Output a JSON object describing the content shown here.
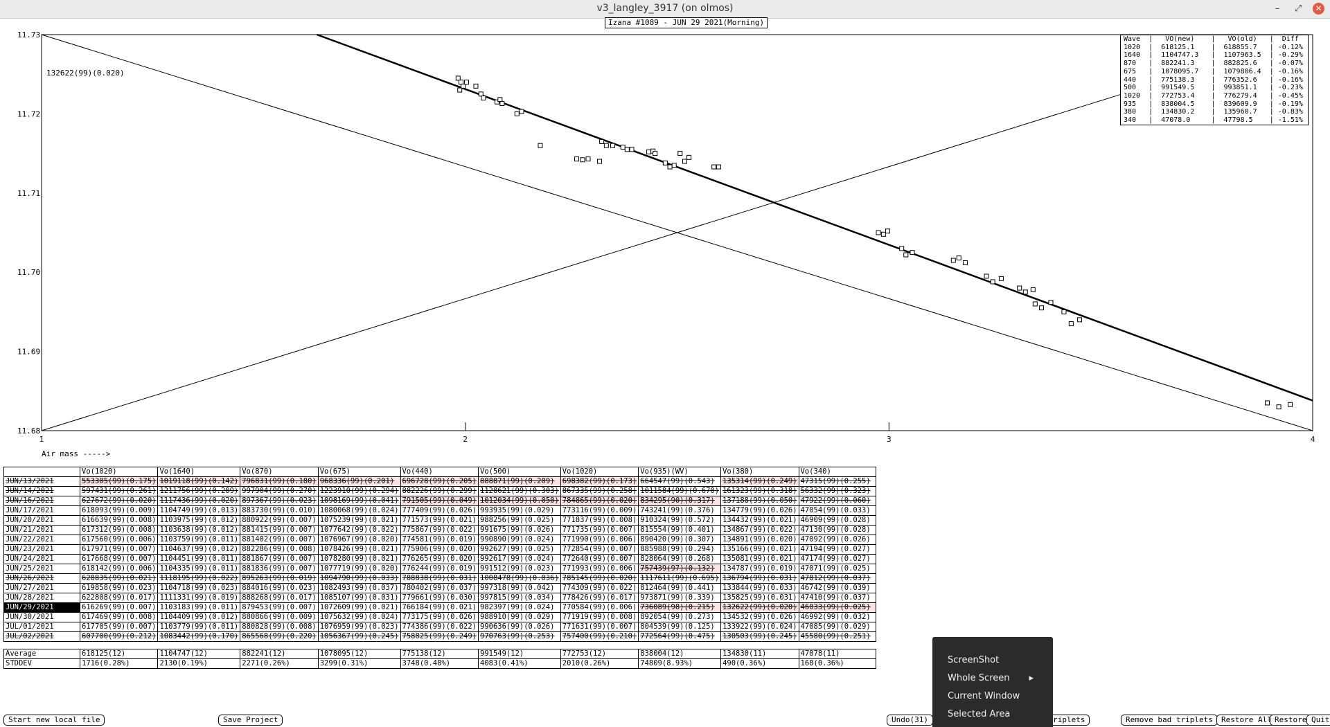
{
  "window": {
    "title": "v3_langley_3917 (on olmos)",
    "minimize_glyph": "–",
    "maximize_glyph": "⤢",
    "close_glyph": "✕"
  },
  "plot": {
    "subtitle": "Izana #1089 - JUN 29 2021(Morning)",
    "annotation": "132622(99)(0.020)",
    "xlabel": "Air mass ----->"
  },
  "chart_data": {
    "type": "scatter",
    "xlabel": "Air mass ----->",
    "ylabel": "",
    "xlim": [
      1,
      4
    ],
    "ylim": [
      11.68,
      11.73
    ],
    "x_ticks": [
      "1",
      "2",
      "3",
      "4"
    ],
    "y_ticks": [
      "11.73",
      "11.72",
      "11.71",
      "11.70",
      "11.69",
      "11.68"
    ],
    "series": [
      {
        "points": [
          [
            1.983,
            11.7245
          ],
          [
            1.99,
            11.724
          ],
          [
            1.995,
            11.7235
          ],
          [
            1.987,
            11.723
          ],
          [
            2.003,
            11.724
          ],
          [
            2.037,
            11.7225
          ],
          [
            2.043,
            11.722
          ],
          [
            2.025,
            11.7235
          ],
          [
            2.075,
            11.7215
          ],
          [
            2.082,
            11.7218
          ],
          [
            2.087,
            11.7213
          ],
          [
            2.122,
            11.72
          ],
          [
            2.133,
            11.7203
          ],
          [
            2.177,
            11.716
          ],
          [
            2.263,
            11.7143
          ],
          [
            2.277,
            11.7142
          ],
          [
            2.29,
            11.7143
          ],
          [
            2.317,
            11.714
          ],
          [
            2.322,
            11.7165
          ],
          [
            2.333,
            11.716
          ],
          [
            2.348,
            11.716
          ],
          [
            2.372,
            11.7158
          ],
          [
            2.382,
            11.7155
          ],
          [
            2.393,
            11.7155
          ],
          [
            2.433,
            11.7152
          ],
          [
            2.443,
            11.7153
          ],
          [
            2.448,
            11.715
          ],
          [
            2.472,
            11.7138
          ],
          [
            2.483,
            11.7133
          ],
          [
            2.493,
            11.7135
          ],
          [
            2.507,
            11.715
          ],
          [
            2.518,
            11.714
          ],
          [
            2.528,
            11.7145
          ],
          [
            2.587,
            11.7133
          ],
          [
            2.598,
            11.7133
          ],
          [
            2.975,
            11.705
          ],
          [
            2.987,
            11.7048
          ],
          [
            2.997,
            11.7052
          ],
          [
            3.03,
            11.703
          ],
          [
            3.04,
            11.7022
          ],
          [
            3.055,
            11.7025
          ],
          [
            3.152,
            11.7015
          ],
          [
            3.165,
            11.7018
          ],
          [
            3.18,
            11.7012
          ],
          [
            3.23,
            11.6995
          ],
          [
            3.245,
            11.6988
          ],
          [
            3.265,
            11.6992
          ],
          [
            3.308,
            11.698
          ],
          [
            3.322,
            11.6975
          ],
          [
            3.34,
            11.6978
          ],
          [
            3.345,
            11.696
          ],
          [
            3.36,
            11.6955
          ],
          [
            3.382,
            11.6962
          ],
          [
            3.413,
            11.695
          ],
          [
            3.43,
            11.6935
          ],
          [
            3.45,
            11.694
          ],
          [
            3.893,
            11.6835
          ],
          [
            3.92,
            11.683
          ],
          [
            3.947,
            11.6833
          ]
        ]
      }
    ],
    "fit_line": [
      [
        1.65,
        11.73
      ],
      [
        4.0,
        11.6838
      ]
    ],
    "envelope_lines": [
      [
        [
          1.0,
          11.73
        ],
        [
          4.0,
          11.68
        ]
      ],
      [
        [
          1.0,
          11.68
        ],
        [
          3.55,
          11.7225
        ]
      ]
    ]
  },
  "legend": {
    "rows": [
      "Wave  |   VO(new)    |   VO(old)   |  Diff",
      "1020  |  618125.1    |  618855.7   | -0.12%",
      "1640  |  1104747.3   |  1107963.5  | -0.29%",
      "870   |  882241.3    |  882825.6   | -0.07%",
      "675   |  1078095.7   |  1079806.4  | -0.16%",
      "440   |  775138.3    |  776352.6   | -0.16%",
      "500   |  991549.5    |  993851.1   | -0.23%",
      "1020  |  772753.4    |  776279.4   | -0.45%",
      "935   |  838004.5    |  839609.9   | -0.19%",
      "380   |  134830.2    |  135960.7   | -0.83%",
      "340   |  47078.0     |  47798.5    | -1.51%"
    ]
  },
  "table": {
    "headers": [
      "",
      "Vo(1020)",
      "Vo(1640)",
      "Vo(870)",
      "Vo(675)",
      "Vo(440)",
      "Vo(500)",
      "Vo(1020)",
      "Vo(935)(WV)",
      "Vo(380)",
      "Vo(340)"
    ],
    "rows": [
      {
        "date": "JUN/13/2021",
        "struck": true,
        "cells": [
          "553305(99)(0.175)",
          "1019118(99)(0.142)",
          "796831(99)(0.180)",
          "968336(99)(0.201)",
          "696728(99)(0.205)",
          "888871(99)(0.209)",
          "698382(99)(0.173)",
          "664547(99)(0.543)",
          "135314(99)(0.249)",
          "47315(99)(0.255)"
        ],
        "bad": [
          0,
          1,
          2,
          3,
          4,
          5,
          6,
          8
        ]
      },
      {
        "date": "JUN/14/2021",
        "struck": true,
        "cells": [
          "597431(99)(0.261)",
          "1211756(99)(0.209)",
          "997904(99)(0.270)",
          "1223910(99)(0.294)",
          "882226(99)(0.299)",
          "1128621(99)(0.303)",
          "867335(99)(0.258)",
          "1011584(99)(0.670)",
          "161323(99)(0.318)",
          "56332(99)(0.323)"
        ],
        "bad": []
      },
      {
        "date": "JUN/16/2021",
        "struck": true,
        "cells": [
          "627672(99)(0.020)",
          "1117436(99)(0.020)",
          "897367(99)(0.023)",
          "1098169(99)(0.041)",
          "791505(99)(0.049)",
          "1012034(99)(0.050)",
          "784865(99)(0.020)",
          "834295(90)(0.317)",
          "137188(99)(0.050)",
          "47922(99)(0.060)"
        ],
        "bad": [
          4,
          5,
          6,
          7
        ]
      },
      {
        "date": "JUN/17/2021",
        "cells": [
          "618093(99)(0.009)",
          "1104749(99)(0.013)",
          "883730(99)(0.010)",
          "1080068(99)(0.024)",
          "777409(99)(0.026)",
          "993935(99)(0.029)",
          "773116(99)(0.009)",
          "743241(99)(0.376)",
          "134779(99)(0.026)",
          "47054(99)(0.033)"
        ],
        "bad": []
      },
      {
        "date": "JUN/20/2021",
        "cells": [
          "616639(99)(0.008)",
          "1103975(99)(0.012)",
          "880922(99)(0.007)",
          "1075239(99)(0.021)",
          "771573(99)(0.021)",
          "988256(99)(0.025)",
          "771837(99)(0.008)",
          "910324(99)(0.572)",
          "134432(99)(0.021)",
          "46909(99)(0.028)"
        ],
        "bad": []
      },
      {
        "date": "JUN/21/2021",
        "cells": [
          "617312(99)(0.008)",
          "1103638(99)(0.012)",
          "881415(99)(0.007)",
          "1077642(99)(0.022)",
          "775867(99)(0.022)",
          "991675(99)(0.026)",
          "771735(99)(0.007)",
          "815554(99)(0.401)",
          "134867(99)(0.022)",
          "47130(99)(0.028)"
        ],
        "bad": []
      },
      {
        "date": "JUN/22/2021",
        "cells": [
          "617560(99)(0.006)",
          "1103759(99)(0.011)",
          "881402(99)(0.007)",
          "1076967(99)(0.020)",
          "774581(99)(0.019)",
          "990890(99)(0.024)",
          "771990(99)(0.006)",
          "890420(99)(0.307)",
          "134891(99)(0.020)",
          "47092(99)(0.026)"
        ],
        "bad": []
      },
      {
        "date": "JUN/23/2021",
        "cells": [
          "617971(99)(0.007)",
          "1104637(99)(0.012)",
          "882286(99)(0.008)",
          "1078426(99)(0.021)",
          "775906(99)(0.020)",
          "992627(99)(0.025)",
          "772854(99)(0.007)",
          "885988(99)(0.294)",
          "135166(99)(0.021)",
          "47194(99)(0.027)"
        ],
        "bad": []
      },
      {
        "date": "JUN/24/2021",
        "cells": [
          "617668(99)(0.007)",
          "1104451(99)(0.011)",
          "881867(99)(0.007)",
          "1078280(99)(0.021)",
          "776265(99)(0.020)",
          "992617(99)(0.024)",
          "772640(99)(0.007)",
          "828064(99)(0.268)",
          "135081(99)(0.021)",
          "47174(99)(0.027)"
        ],
        "bad": []
      },
      {
        "date": "JUN/25/2021",
        "cells": [
          "618142(99)(0.006)",
          "1104335(99)(0.011)",
          "881836(99)(0.007)",
          "1077719(99)(0.020)",
          "776244(99)(0.019)",
          "991512(99)(0.023)",
          "771993(99)(0.006)",
          "757439(97)(0.132)",
          "134787(99)(0.019)",
          "47071(99)(0.025)"
        ],
        "bad": [
          7
        ]
      },
      {
        "date": "JUN/26/2021",
        "struck": true,
        "cells": [
          "628835(99)(0.021)",
          "1118195(99)(0.022)",
          "895263(99)(0.019)",
          "1094790(99)(0.033)",
          "788838(99)(0.031)",
          "1008478(99)(0.036)",
          "785145(99)(0.020)",
          "1117611(99)(0.695)",
          "136794(99)(0.031)",
          "47812(99)(0.037)"
        ],
        "bad": []
      },
      {
        "date": "JUN/27/2021",
        "cells": [
          "619858(99)(0.023)",
          "1104718(99)(0.023)",
          "884016(99)(0.023)",
          "1082493(99)(0.037)",
          "780402(99)(0.037)",
          "997318(99)(0.042)",
          "774309(99)(0.022)",
          "812464(99)(0.441)",
          "133844(99)(0.033)",
          "46742(99)(0.039)"
        ],
        "bad": []
      },
      {
        "date": "JUN/28/2021",
        "cells": [
          "622808(99)(0.017)",
          "1111331(99)(0.019)",
          "888268(99)(0.017)",
          "1085107(99)(0.031)",
          "779661(99)(0.030)",
          "997815(99)(0.034)",
          "778426(99)(0.017)",
          "973871(99)(0.339)",
          "135825(99)(0.031)",
          "47410(99)(0.037)"
        ],
        "bad": []
      },
      {
        "date": "JUN/29/2021",
        "selected": true,
        "cells": [
          "616269(99)(0.007)",
          "1103183(99)(0.011)",
          "879453(99)(0.007)",
          "1072609(99)(0.021)",
          "766184(99)(0.021)",
          "982397(99)(0.024)",
          "770584(99)(0.006)",
          "736089(98)(0.215)",
          "132622(99)(0.020)",
          "46033(99)(0.025)"
        ],
        "bad": [
          7,
          8,
          9
        ]
      },
      {
        "date": "JUN/30/2021",
        "cells": [
          "617469(99)(0.008)",
          "1104409(99)(0.012)",
          "880866(99)(0.009)",
          "1075632(99)(0.024)",
          "773175(99)(0.026)",
          "988910(99)(0.029)",
          "771919(99)(0.008)",
          "892054(99)(0.273)",
          "134532(99)(0.026)",
          "46992(99)(0.032)"
        ],
        "bad": []
      },
      {
        "date": "JUL/01/2021",
        "cells": [
          "617705(99)(0.007)",
          "1103779(99)(0.011)",
          "880828(99)(0.008)",
          "1076959(99)(0.023)",
          "774386(99)(0.022)",
          "990636(99)(0.026)",
          "771631(99)(0.007)",
          "804539(99)(0.125)",
          "133922(99)(0.024)",
          "47085(99)(0.029)"
        ],
        "bad": []
      },
      {
        "date": "JUL/02/2021",
        "struck": true,
        "cells": [
          "607700(99)(0.212)",
          "1083442(99)(0.170)",
          "865568(99)(0.220)",
          "1056367(99)(0.245)",
          "758825(99)(0.249)",
          "970763(99)(0.253)",
          "757400(99)(0.210)",
          "772564(99)(0.475)",
          "130503(99)(0.245)",
          "45580(99)(0.251)"
        ],
        "bad": []
      }
    ],
    "average": {
      "label": "Average",
      "cells": [
        "618125(12)",
        "1104747(12)",
        "882241(12)",
        "1078095(12)",
        "775138(12)",
        "991549(12)",
        "772753(12)",
        "838004(12)",
        "134830(11)",
        "47078(11)"
      ]
    },
    "stddev": {
      "label": "STDDEV",
      "cells": [
        "1716(0.28%)",
        "2130(0.19%)",
        "2271(0.26%)",
        "3299(0.31%)",
        "3748(0.48%)",
        "4083(0.41%)",
        "2010(0.26%)",
        "74809(8.93%)",
        " 490(0.36%)",
        " 168(0.36%)"
      ]
    }
  },
  "buttons": {
    "start_new": "Start new local file",
    "save_project": "Save Project",
    "undo": "Undo(31)",
    "bad_triplets": "bad triplets",
    "remove_bad": "Remove bad triplets",
    "restore_all": "Restore All",
    "restore": "Restore",
    "quit": "Quit"
  },
  "context_menu": {
    "items": [
      "ScreenShot",
      "Whole Screen",
      "Current Window",
      "Selected Area"
    ],
    "submenu_arrow": "▸"
  }
}
